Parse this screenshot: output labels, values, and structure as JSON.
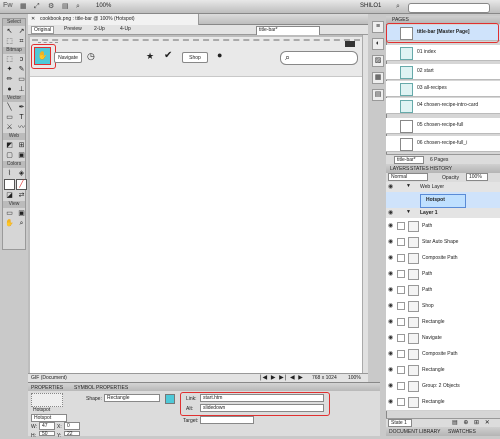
{
  "app": {
    "app_label": "Fw",
    "zoom": "100%",
    "workspace": "SHILO1"
  },
  "document": {
    "tab_title": "cookbook.png : title-bar @ 100% (Hotspot)",
    "page_select": "title-bar*",
    "view_tabs": [
      "Original",
      "Preview",
      "2-Up",
      "4-Up"
    ]
  },
  "toolbox": {
    "sections": [
      "Select",
      "Bitmap",
      "Vector",
      "Web",
      "Colors",
      "View"
    ]
  },
  "canvas": {
    "navigate_label": "Navigate",
    "shop_label": "Shop",
    "accent_color": "#4ec9d8",
    "hotspot_color": "#4ec9d8"
  },
  "status_bar": {
    "format": "GIF (Document)",
    "size": "768 x 1024",
    "zoom": "100%"
  },
  "properties": {
    "tabs": [
      "PROPERTIES",
      "SYMBOL PROPERTIES"
    ],
    "object_type": "Hotspot",
    "object_name": "Hotspot",
    "shape_label": "Shape:",
    "shape_value": "Rectangle",
    "w_label": "W:",
    "w_value": "47",
    "h_label": "H:",
    "h_value": "50",
    "x_label": "X:",
    "x_value": "0",
    "y_label": "Y:",
    "y_value": "22",
    "link_label": "Link:",
    "link_value": "start.htm",
    "alt_label": "Alt:",
    "alt_value": "slidedown",
    "target_label": "Target:",
    "target_value": ""
  },
  "pages_panel": {
    "title": "PAGES",
    "pages": [
      "title-bar [Master Page]",
      "01  index",
      "02  start",
      "03  all-recipes",
      "04  chosen-recipe-intro-card",
      "05  chosen-recipe-full",
      "06  chosen-recipe-full_i"
    ],
    "page_select": "title-bar*",
    "page_count": "6 Pages"
  },
  "layers_panel": {
    "tabs": [
      "LAYERS",
      "STATES",
      "HISTORY"
    ],
    "blend_mode": "Normal",
    "opacity_label": "Opacity",
    "opacity": "100%",
    "layers": [
      "Web Layer",
      "Hotspot",
      "Layer 1",
      "Path",
      "Star Auto Shape",
      "Composite Path",
      "Path",
      "Path",
      "Shop",
      "Rectangle",
      "Navigate",
      "Composite Path",
      "Rectangle",
      "Group: 2 Objects",
      "Rectangle"
    ],
    "state": "State 1"
  },
  "bottom_tabs": [
    "DOCUMENT LIBRARY",
    "SWATCHES"
  ]
}
